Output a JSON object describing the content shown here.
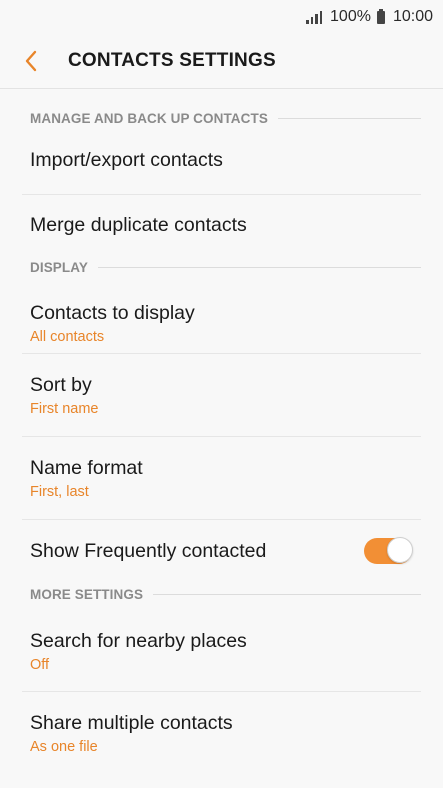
{
  "status_bar": {
    "battery": "100%",
    "time": "10:00"
  },
  "header": {
    "title": "CONTACTS SETTINGS"
  },
  "sections": {
    "manage": {
      "title": "MANAGE AND BACK UP CONTACTS",
      "import_export": "Import/export contacts",
      "merge": "Merge duplicate contacts"
    },
    "display": {
      "title": "DISPLAY",
      "contacts_to_display": {
        "label": "Contacts to display",
        "value": "All contacts"
      },
      "sort_by": {
        "label": "Sort by",
        "value": "First name"
      },
      "name_format": {
        "label": "Name format",
        "value": "First, last"
      },
      "show_frequent": {
        "label": "Show Frequently contacted",
        "enabled": true
      }
    },
    "more": {
      "title": "MORE SETTINGS",
      "nearby": {
        "label": "Search for nearby places",
        "value": "Off"
      },
      "share": {
        "label": "Share multiple contacts",
        "value": "As one file"
      }
    }
  },
  "colors": {
    "accent": "#e8852a",
    "toggle_on": "#f28f35",
    "section_title": "#8a8a8a"
  }
}
